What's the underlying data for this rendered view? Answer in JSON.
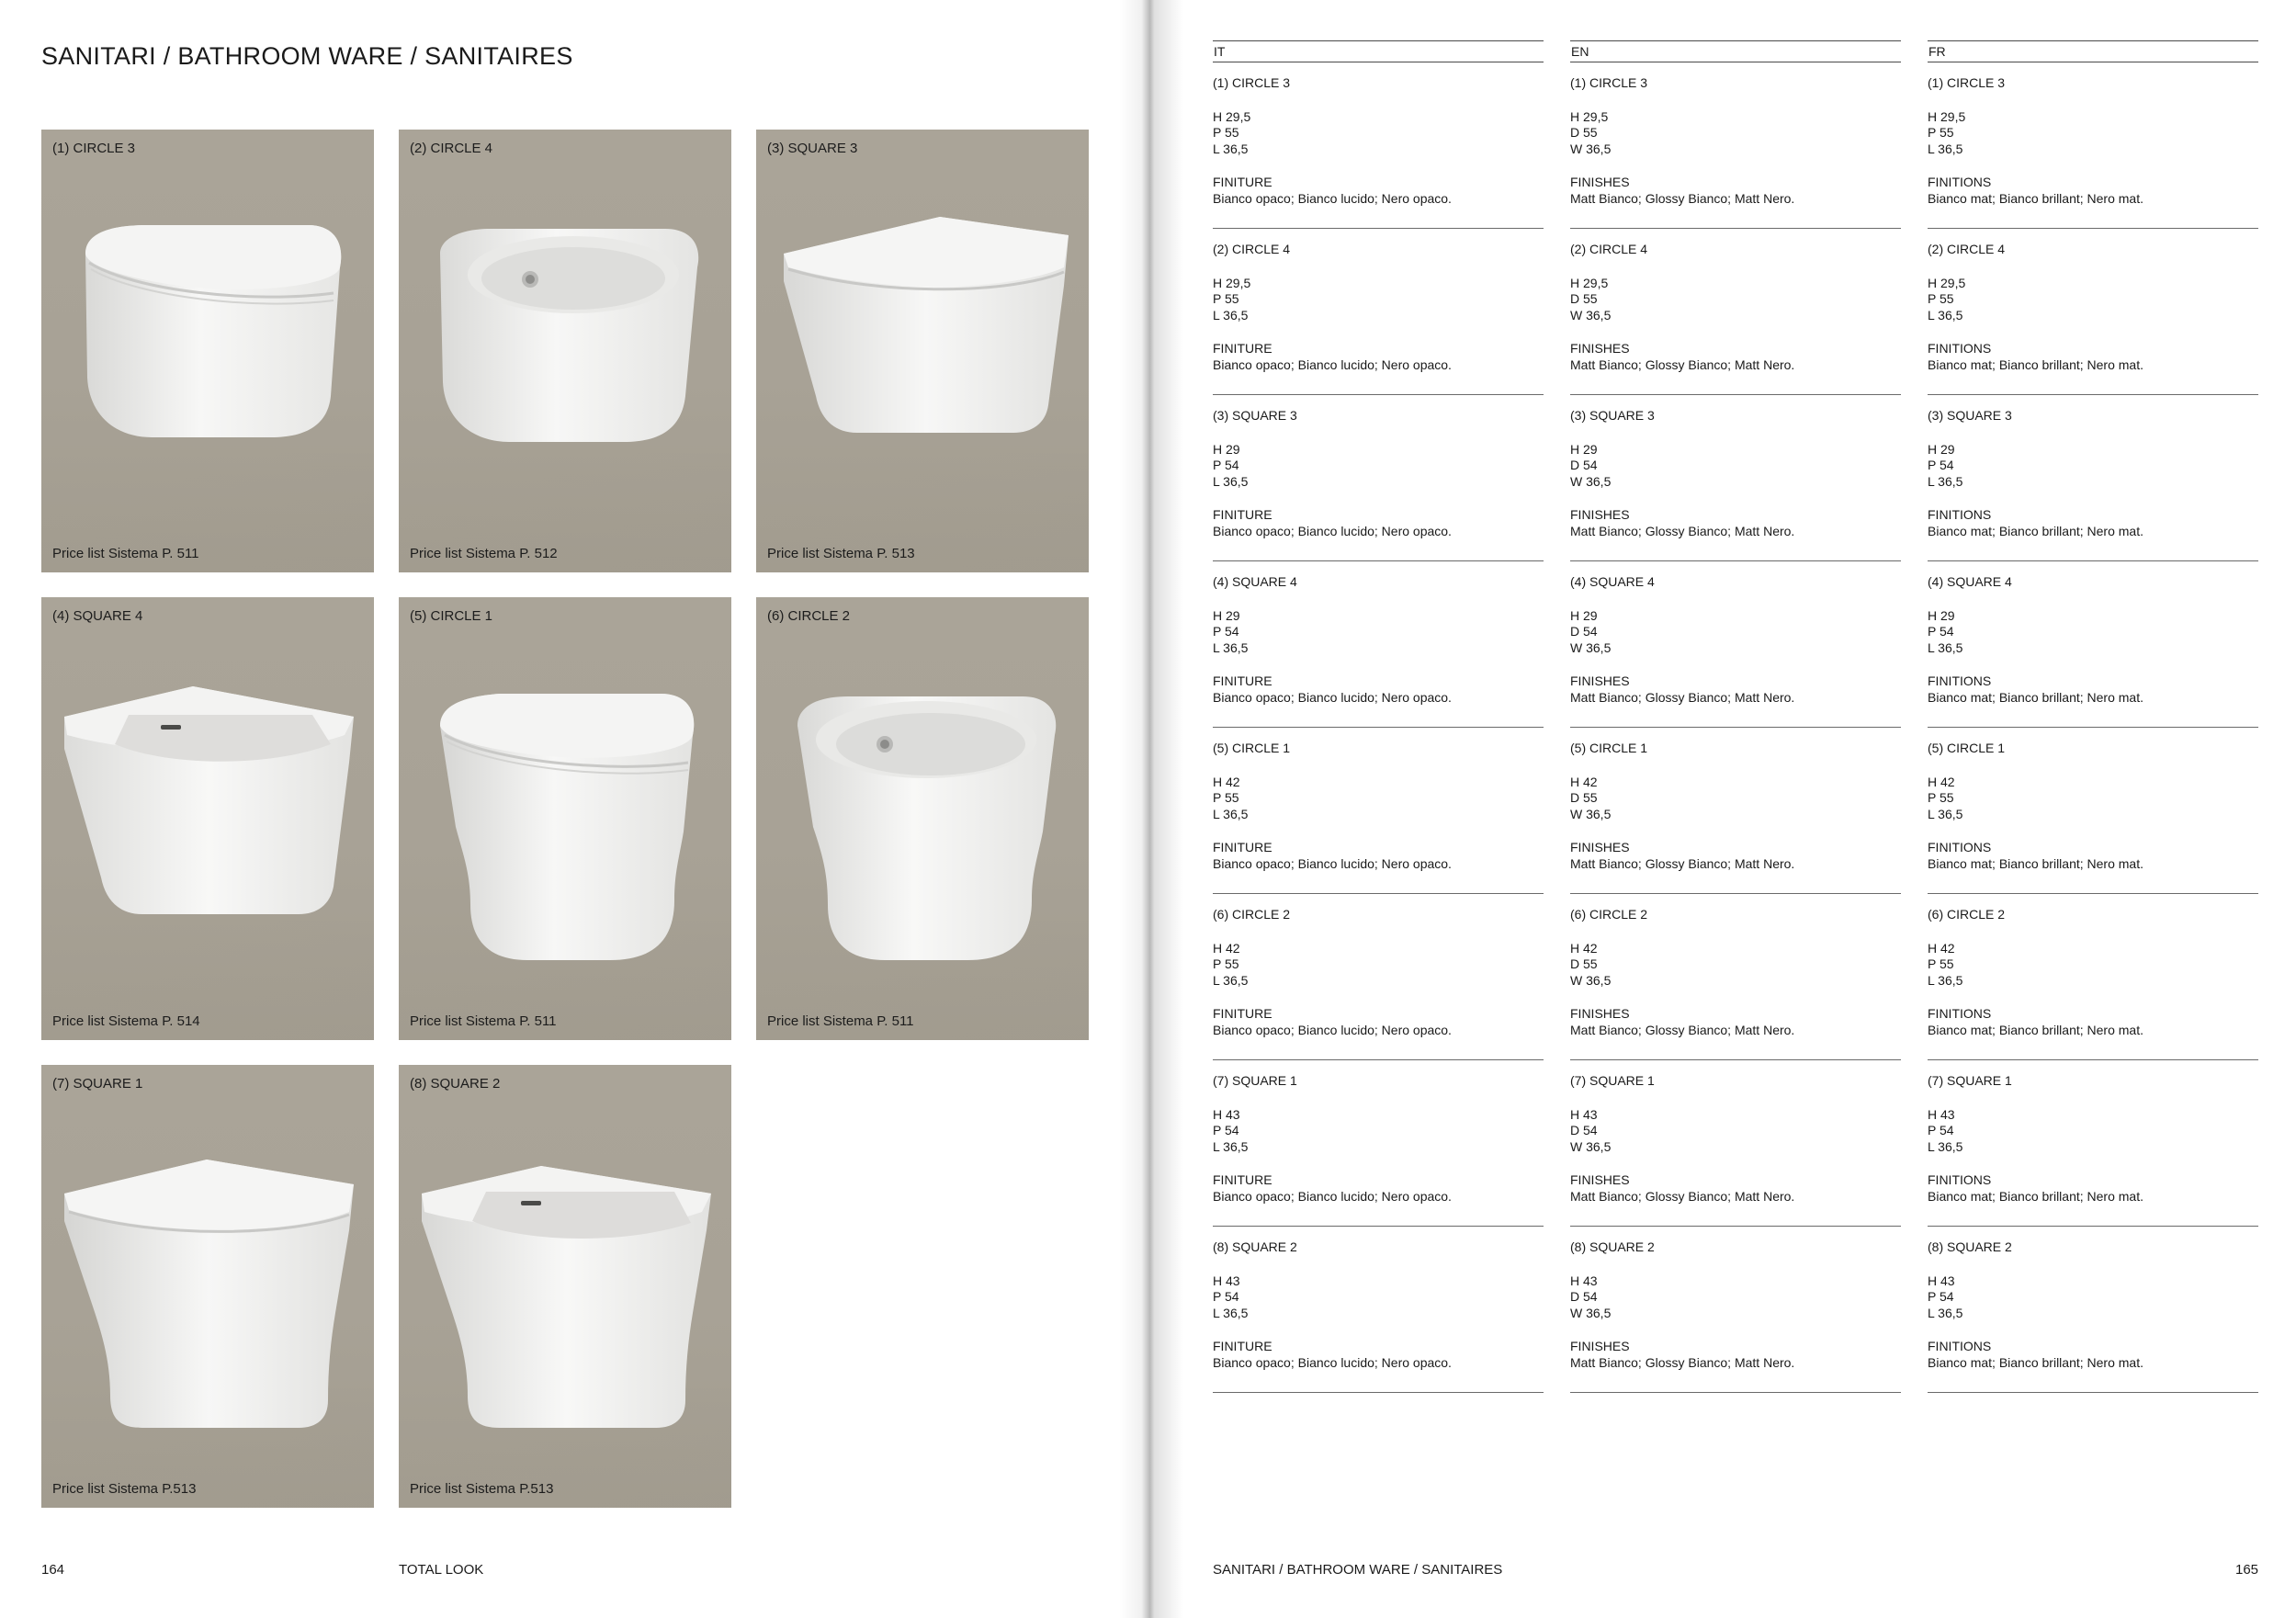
{
  "left_page": {
    "title": "SANITARI / BATHROOM WARE / SANITAIRES",
    "page_number": "164",
    "section": "TOTAL LOOK",
    "cards": [
      {
        "label": "(1) CIRCLE 3",
        "price": "Price list Sistema P. 511"
      },
      {
        "label": "(2) CIRCLE 4",
        "price": "Price list Sistema P. 512"
      },
      {
        "label": "(3) SQUARE 3",
        "price": "Price list Sistema P. 513"
      },
      {
        "label": "(4) SQUARE 4",
        "price": "Price list Sistema P. 514"
      },
      {
        "label": "(5) CIRCLE 1",
        "price": "Price list Sistema P. 511"
      },
      {
        "label": "(6) CIRCLE 2",
        "price": "Price list Sistema P. 511"
      },
      {
        "label": "(7) SQUARE 1",
        "price": "Price list Sistema P.513"
      },
      {
        "label": "(8) SQUARE 2",
        "price": "Price list Sistema P.513"
      }
    ]
  },
  "right_page": {
    "footer_title": "SANITARI / BATHROOM WARE / SANITAIRES",
    "page_number": "165",
    "columns": [
      {
        "lang": "IT",
        "finish_label": "FINITURE",
        "finishes": "Bianco opaco; Bianco lucido; Nero opaco.",
        "products": [
          {
            "name": "(1) CIRCLE 3",
            "h": "H 29,5",
            "d": "P 55",
            "w": "L 36,5"
          },
          {
            "name": "(2) CIRCLE 4",
            "h": "H 29,5",
            "d": "P 55",
            "w": "L 36,5"
          },
          {
            "name": "(3) SQUARE 3",
            "h": "H 29",
            "d": "P 54",
            "w": "L 36,5"
          },
          {
            "name": "(4) SQUARE 4",
            "h": "H 29",
            "d": "P 54",
            "w": "L 36,5"
          },
          {
            "name": "(5) CIRCLE 1",
            "h": "H 42",
            "d": "P 55",
            "w": "L 36,5"
          },
          {
            "name": "(6) CIRCLE 2",
            "h": "H 42",
            "d": "P 55",
            "w": "L 36,5"
          },
          {
            "name": "(7) SQUARE 1",
            "h": "H 43",
            "d": "P 54",
            "w": "L 36,5"
          },
          {
            "name": "(8) SQUARE 2",
            "h": "H 43",
            "d": "P 54",
            "w": "L 36,5"
          }
        ]
      },
      {
        "lang": "EN",
        "finish_label": "FINISHES",
        "finishes": "Matt Bianco; Glossy Bianco; Matt Nero.",
        "products": [
          {
            "name": "(1) CIRCLE 3",
            "h": "H 29,5",
            "d": "D 55",
            "w": "W 36,5"
          },
          {
            "name": "(2) CIRCLE 4",
            "h": "H 29,5",
            "d": "D 55",
            "w": "W 36,5"
          },
          {
            "name": "(3) SQUARE 3",
            "h": "H 29",
            "d": "D 54",
            "w": "W 36,5"
          },
          {
            "name": "(4) SQUARE 4",
            "h": "H 29",
            "d": "D 54",
            "w": "W 36,5"
          },
          {
            "name": "(5) CIRCLE 1",
            "h": "H 42",
            "d": "D 55",
            "w": "W 36,5"
          },
          {
            "name": "(6) CIRCLE 2",
            "h": "H 42",
            "d": "D 55",
            "w": "W 36,5"
          },
          {
            "name": "(7) SQUARE 1",
            "h": "H 43",
            "d": "D 54",
            "w": "W 36,5"
          },
          {
            "name": "(8) SQUARE 2",
            "h": "H 43",
            "d": "D 54",
            "w": "W 36,5"
          }
        ]
      },
      {
        "lang": "FR",
        "finish_label": "FINITIONS",
        "finishes": "Bianco mat; Bianco brillant; Nero mat.",
        "products": [
          {
            "name": "(1) CIRCLE 3",
            "h": "H 29,5",
            "d": "P 55",
            "w": "L 36,5"
          },
          {
            "name": "(2) CIRCLE 4",
            "h": "H 29,5",
            "d": "P 55",
            "w": "L 36,5"
          },
          {
            "name": "(3) SQUARE 3",
            "h": "H 29",
            "d": "P 54",
            "w": "L 36,5"
          },
          {
            "name": "(4) SQUARE 4",
            "h": "H 29",
            "d": "P 54",
            "w": "L 36,5"
          },
          {
            "name": "(5) CIRCLE 1",
            "h": "H 42",
            "d": "P 55",
            "w": "L 36,5"
          },
          {
            "name": "(6) CIRCLE 2",
            "h": "H 42",
            "d": "P 55",
            "w": "L 36,5"
          },
          {
            "name": "(7) SQUARE 1",
            "h": "H 43",
            "d": "P 54",
            "w": "L 36,5"
          },
          {
            "name": "(8) SQUARE 2",
            "h": "H 43",
            "d": "P 54",
            "w": "L 36,5"
          }
        ]
      }
    ]
  }
}
